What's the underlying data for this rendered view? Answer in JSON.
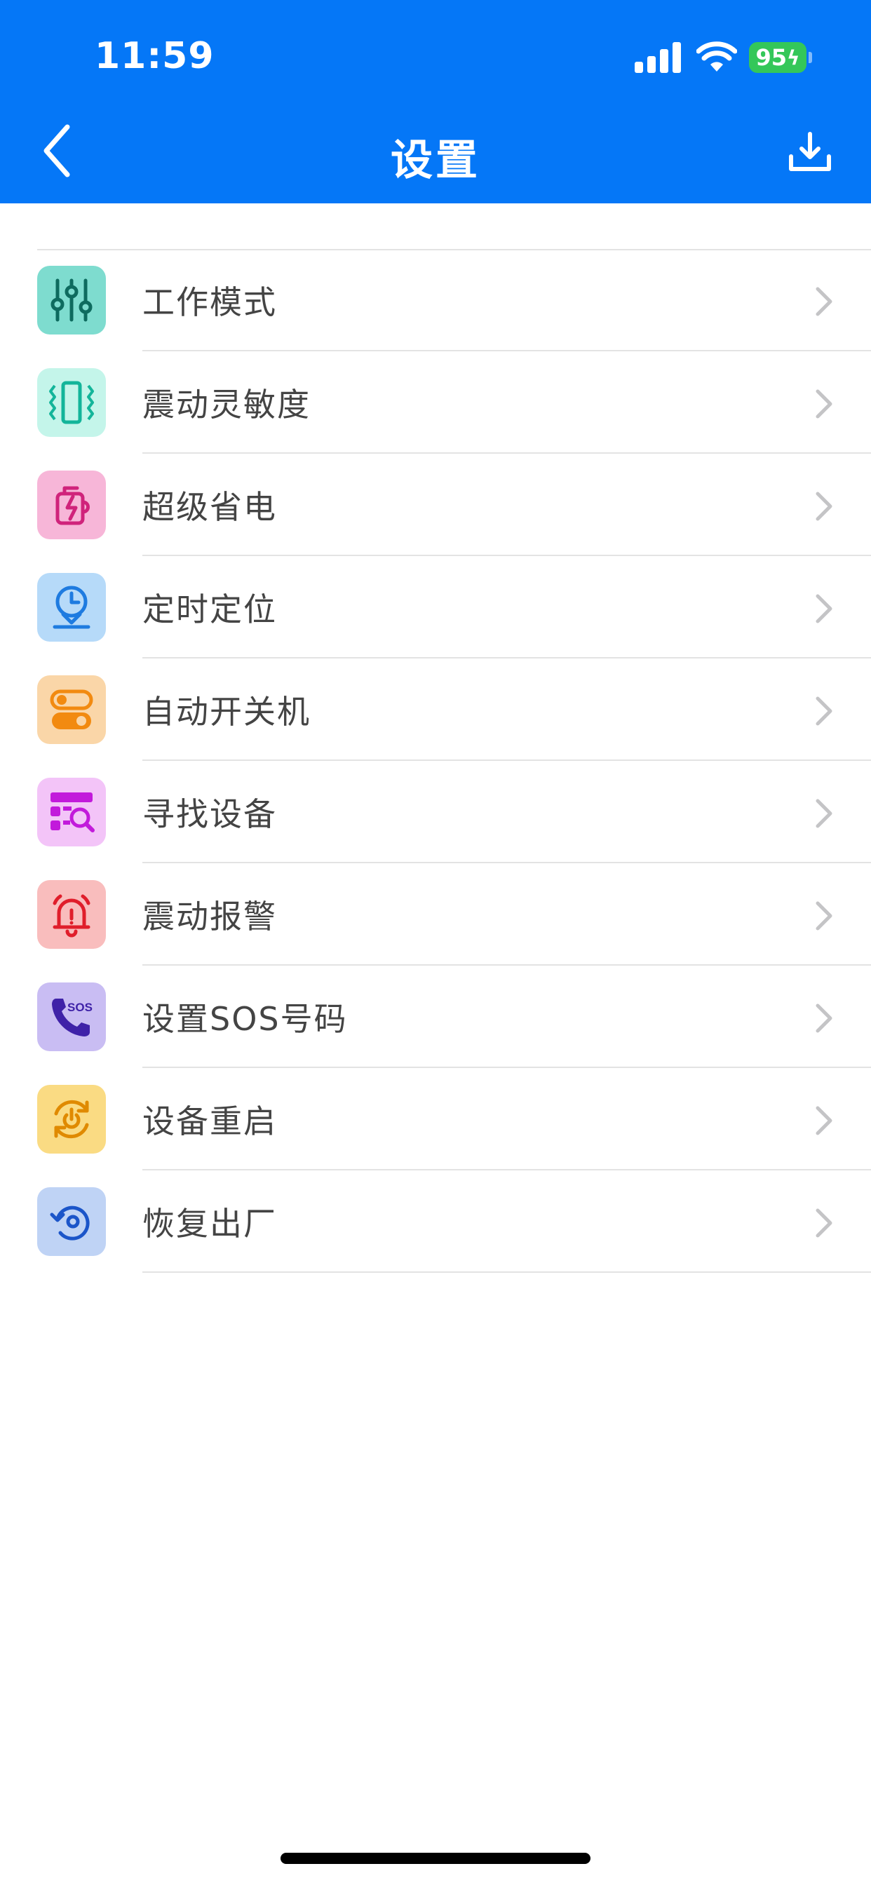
{
  "status": {
    "time": "11:59",
    "battery": "95"
  },
  "header": {
    "title": "设置"
  },
  "colors": {
    "accent": "#0577F7",
    "battery": "#34C759"
  },
  "items": [
    {
      "label": "工作模式",
      "icon": "sliders-icon"
    },
    {
      "label": "震动灵敏度",
      "icon": "vibration-icon"
    },
    {
      "label": "超级省电",
      "icon": "power-save-icon"
    },
    {
      "label": "定时定位",
      "icon": "clock-location-icon"
    },
    {
      "label": "自动开关机",
      "icon": "toggle-icon"
    },
    {
      "label": "寻找设备",
      "icon": "find-device-icon"
    },
    {
      "label": "震动报警",
      "icon": "alarm-bell-icon"
    },
    {
      "label": "设置SOS号码",
      "icon": "sos-phone-icon"
    },
    {
      "label": "设备重启",
      "icon": "restart-icon"
    },
    {
      "label": "恢复出厂",
      "icon": "factory-reset-icon"
    }
  ]
}
